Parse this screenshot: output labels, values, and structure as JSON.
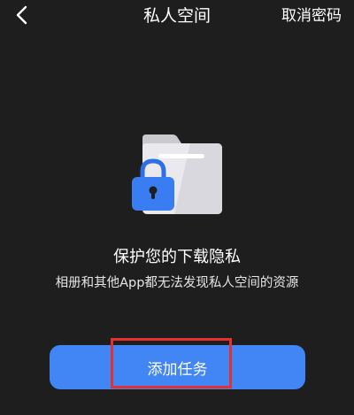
{
  "header": {
    "title": "私人空间",
    "back_icon": "chevron-left-icon",
    "cancel_password_label": "取消密码"
  },
  "hero": {
    "icon": "locked-folder-icon"
  },
  "main": {
    "headline": "保护您的下载隐私",
    "description": "相册和其他App都无法发现私人空间的资源"
  },
  "action": {
    "add_task_label": "添加任务"
  },
  "colors": {
    "background": "#1e1e1e",
    "accent": "#4285f4",
    "highlight": "#e53030"
  }
}
